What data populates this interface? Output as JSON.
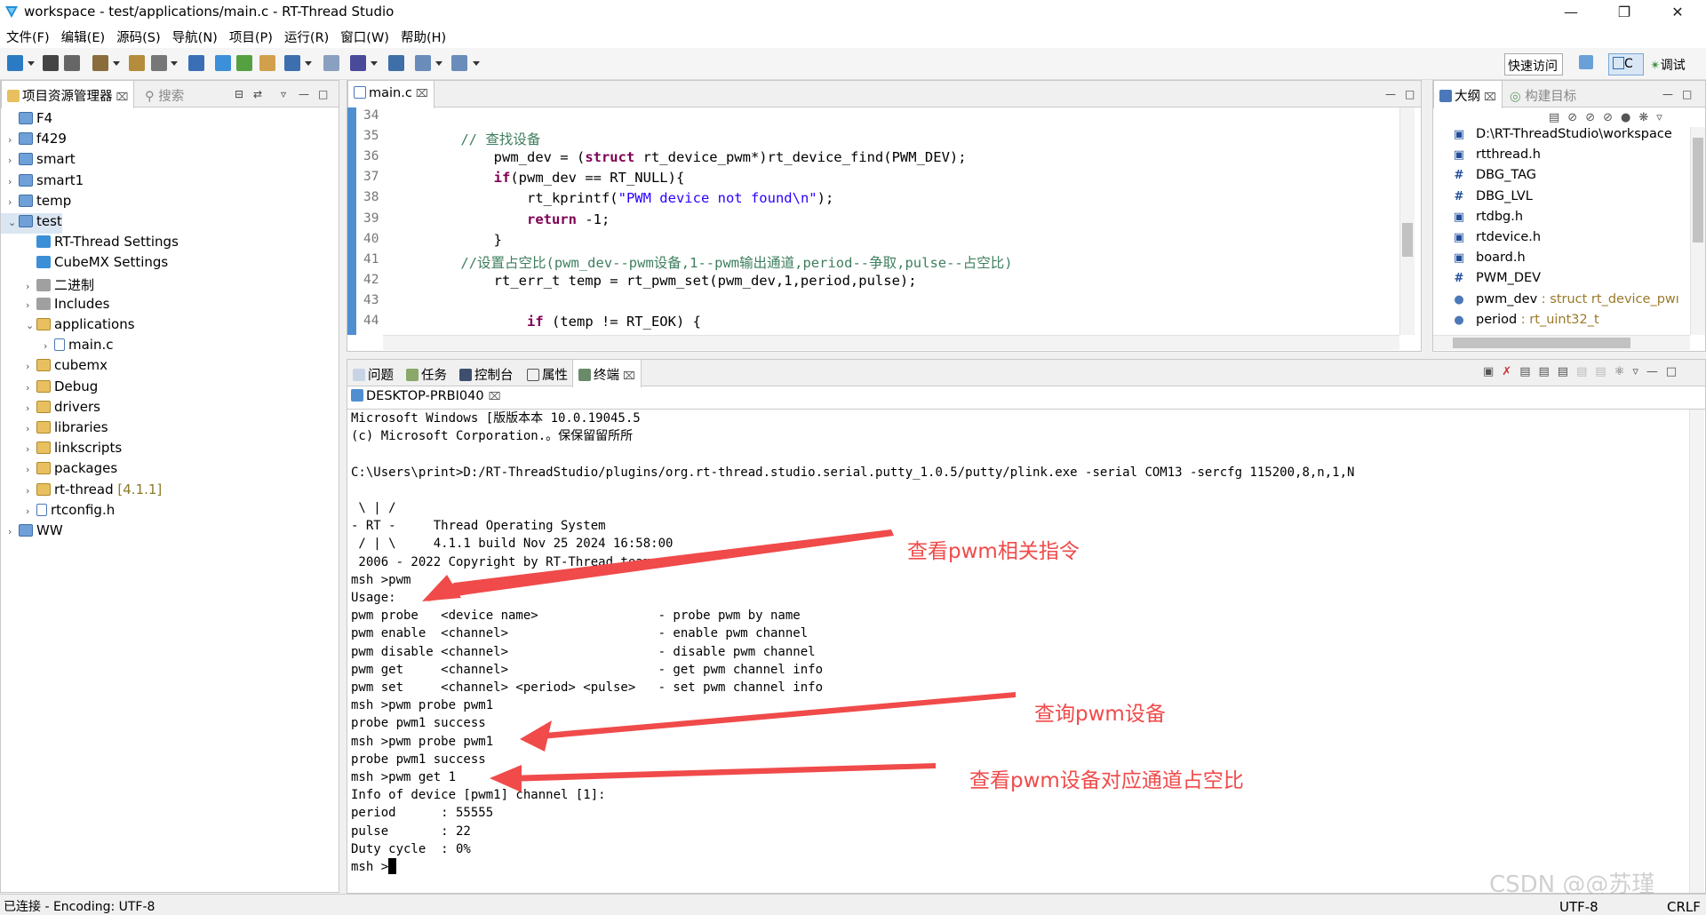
{
  "window": {
    "title": "workspace - test/applications/main.c - RT-Thread Studio"
  },
  "menu": [
    "文件(F)",
    "编辑(E)",
    "源码(S)",
    "导航(N)",
    "项目(P)",
    "运行(R)",
    "窗口(W)",
    "帮助(H)"
  ],
  "toolbar": {
    "quick_access": "快速访问",
    "perspective_c": "C",
    "perspective_debug": "调试"
  },
  "project_explorer": {
    "tab_label": "项目资源管理器",
    "search_tab": "搜索",
    "items": [
      {
        "label": "F4",
        "depth": 0,
        "expanded": false,
        "kind": "project",
        "has_arrow": false
      },
      {
        "label": "f429",
        "depth": 0,
        "kind": "project",
        "has_arrow": true
      },
      {
        "label": "smart",
        "depth": 0,
        "kind": "project",
        "has_arrow": true
      },
      {
        "label": "smart1",
        "depth": 0,
        "kind": "project",
        "has_arrow": true
      },
      {
        "label": "temp",
        "depth": 0,
        "kind": "project",
        "has_arrow": true
      },
      {
        "label": "test",
        "depth": 0,
        "kind": "project",
        "has_arrow": true,
        "expanded": true,
        "selected": true
      },
      {
        "label": "RT-Thread Settings",
        "depth": 1,
        "kind": "settings",
        "has_arrow": false
      },
      {
        "label": "CubeMX Settings",
        "depth": 1,
        "kind": "cubemx",
        "has_arrow": false
      },
      {
        "label": "二进制",
        "depth": 1,
        "kind": "binary",
        "has_arrow": true
      },
      {
        "label": "Includes",
        "depth": 1,
        "kind": "includes",
        "has_arrow": true
      },
      {
        "label": "applications",
        "depth": 1,
        "kind": "folder",
        "has_arrow": true,
        "expanded": true
      },
      {
        "label": "main.c",
        "depth": 2,
        "kind": "file",
        "has_arrow": true
      },
      {
        "label": "cubemx",
        "depth": 1,
        "kind": "folder",
        "has_arrow": true
      },
      {
        "label": "Debug",
        "depth": 1,
        "kind": "folder",
        "has_arrow": true
      },
      {
        "label": "drivers",
        "depth": 1,
        "kind": "folder",
        "has_arrow": true
      },
      {
        "label": "libraries",
        "depth": 1,
        "kind": "folder",
        "has_arrow": true
      },
      {
        "label": "linkscripts",
        "depth": 1,
        "kind": "folder",
        "has_arrow": true
      },
      {
        "label": "packages",
        "depth": 1,
        "kind": "folder",
        "has_arrow": true
      },
      {
        "label": "rt-thread",
        "version": "[4.1.1]",
        "depth": 1,
        "kind": "folder",
        "has_arrow": true
      },
      {
        "label": "rtconfig.h",
        "depth": 1,
        "kind": "file",
        "has_arrow": true
      },
      {
        "label": "WW",
        "depth": 0,
        "kind": "project",
        "has_arrow": true
      }
    ]
  },
  "editor": {
    "tab_label": "main.c",
    "lines": [
      {
        "n": "34",
        "html": ""
      },
      {
        "n": "35",
        "html": "    <span class='cm'>// 查找设备</span>"
      },
      {
        "n": "36",
        "html": "        pwm_dev = (<span class='kw'>struct</span> rt_device_pwm*)rt_device_find(PWM_DEV);"
      },
      {
        "n": "37",
        "html": "        <span class='kw'>if</span>(pwm_dev == RT_NULL){"
      },
      {
        "n": "38",
        "html": "            rt_kprintf(<span class='str'>\"PWM device not found\\n\"</span>);"
      },
      {
        "n": "39",
        "html": "            <span class='kw'>return</span> -1;"
      },
      {
        "n": "40",
        "html": "        }"
      },
      {
        "n": "41",
        "html": "    <span class='cm'>//设置占空比(pwm_dev--pwm设备,1--pwm输出通道,period--争取,pulse--占空比)</span>"
      },
      {
        "n": "42",
        "html": "        rt_err_t temp = rt_pwm_set(pwm_dev,1,period,pulse);"
      },
      {
        "n": "43",
        "html": ""
      },
      {
        "n": "44",
        "html": "            <span class='kw'>if</span> (temp != RT_EOK) {"
      }
    ]
  },
  "outline": {
    "tab_label": "大纲",
    "build_target_tab": "构建目标",
    "items": [
      {
        "icon": "▣",
        "label": "D:\\RT-ThreadStudio\\workspace",
        "type": ""
      },
      {
        "icon": "▣",
        "label": "rtthread.h",
        "type": ""
      },
      {
        "icon": "#",
        "label": "DBG_TAG",
        "type": ""
      },
      {
        "icon": "#",
        "label": "DBG_LVL",
        "type": ""
      },
      {
        "icon": "▣",
        "label": "rtdbg.h",
        "type": ""
      },
      {
        "icon": "▣",
        "label": "rtdevice.h",
        "type": ""
      },
      {
        "icon": "▣",
        "label": "board.h",
        "type": ""
      },
      {
        "icon": "#",
        "label": "PWM_DEV",
        "type": ""
      },
      {
        "icon": "●",
        "label": "pwm_dev",
        "type": " : struct rt_device_pwı"
      },
      {
        "icon": "●",
        "label": "period",
        "type": " : rt_uint32_t"
      }
    ]
  },
  "bottom_tabs": [
    "问题",
    "任务",
    "控制台",
    "属性",
    "终端"
  ],
  "terminal": {
    "tab_label": "DESKTOP-PRBI040",
    "lines": [
      "Microsoft Windows [版版本本 10.0.19045.5",
      "(c) Microsoft Corporation.。保保留留所所",
      "",
      "C:\\Users\\print>D:/RT-ThreadStudio/plugins/org.rt-thread.studio.serial.putty_1.0.5/putty/plink.exe -serial COM13 -sercfg 115200,8,n,1,N",
      "",
      " \\ | /",
      "- RT -     Thread Operating System",
      " / | \\     4.1.1 build Nov 25 2024 16:58:00",
      " 2006 - 2022 Copyright by RT-Thread team",
      "msh >pwm",
      "Usage:",
      "pwm probe   <device name>                - probe pwm by name",
      "pwm enable  <channel>                    - enable pwm channel",
      "pwm disable <channel>                    - disable pwm channel",
      "pwm get     <channel>                    - get pwm channel info",
      "pwm set     <channel> <period> <pulse>   - set pwm channel info",
      "msh >pwm probe pwm1",
      "probe pwm1 success",
      "msh >pwm probe pwm1",
      "probe pwm1 success",
      "msh >pwm get 1",
      "Info of device [pwm1] channel [1]:",
      "period      : 55555",
      "pulse       : 22",
      "Duty cycle  : 0%",
      "msh >"
    ]
  },
  "annotations": [
    {
      "text": "查看pwm相关指令"
    },
    {
      "text": "查询pwm设备"
    },
    {
      "text": "查看pwm设备对应通道占空比"
    }
  ],
  "status": {
    "left": "已连接 - Encoding: UTF-8",
    "encoding": "UTF-8",
    "line_ending": "CRLF"
  },
  "watermark": "CSDN @@苏瑾",
  "colors": {
    "annotation": "#f04a4a",
    "keyword": "#7f0055",
    "comment": "#3f7f5f",
    "string": "#2a00ff"
  }
}
